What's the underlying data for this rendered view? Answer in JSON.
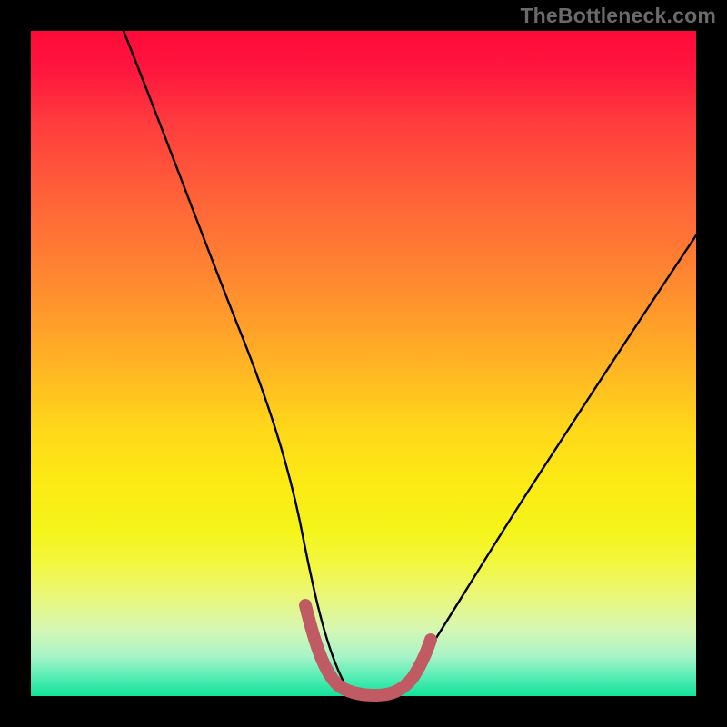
{
  "watermark": "TheBottleneck.com",
  "chart_data": {
    "type": "line",
    "title": "",
    "xlabel": "",
    "ylabel": "",
    "xlim": [
      0,
      100
    ],
    "ylim": [
      0,
      100
    ],
    "grid": false,
    "note": "Axis values are normalized 0–100; no tick labels shown in source image.",
    "series": [
      {
        "name": "main-curve",
        "color": "#000000",
        "x": [
          14,
          20,
          25,
          30,
          35,
          38,
          40,
          42,
          44,
          46,
          48,
          50,
          52,
          55,
          60,
          65,
          70,
          75,
          80,
          85,
          90,
          95,
          100
        ],
        "values": [
          100,
          82,
          69,
          55,
          40,
          30,
          22,
          15,
          9,
          4,
          1,
          0,
          0,
          0,
          3,
          10,
          19,
          28,
          37,
          46,
          55,
          63,
          70
        ]
      },
      {
        "name": "highlight-band",
        "color": "#c05a63",
        "x": [
          42,
          44,
          46,
          48,
          50,
          52,
          54,
          56,
          58
        ],
        "values": [
          13,
          8,
          4,
          1,
          0,
          0,
          0,
          1,
          4
        ]
      }
    ],
    "gradient_stops": [
      {
        "pos": 0,
        "color": "#ff0a3a"
      },
      {
        "pos": 14,
        "color": "#ff3d3e"
      },
      {
        "pos": 38,
        "color": "#ff8a30"
      },
      {
        "pos": 60,
        "color": "#ffd81a"
      },
      {
        "pos": 80,
        "color": "#f3f73e"
      },
      {
        "pos": 94,
        "color": "#a8f4c8"
      },
      {
        "pos": 100,
        "color": "#10e39a"
      }
    ]
  }
}
